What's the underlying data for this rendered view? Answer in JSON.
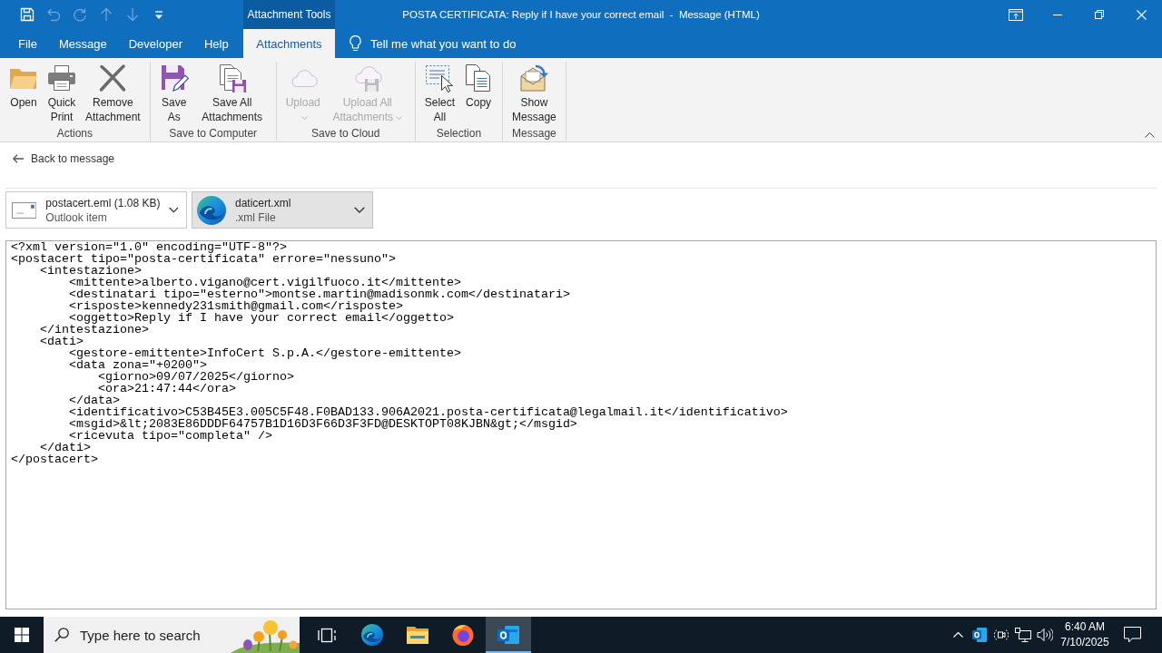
{
  "title_bar": {
    "quick_access": [
      {
        "kind": "save",
        "disabled": false
      },
      {
        "kind": "undo",
        "disabled": true
      },
      {
        "kind": "redo",
        "disabled": true
      },
      {
        "kind": "up",
        "disabled": true
      },
      {
        "kind": "down",
        "disabled": true
      },
      {
        "kind": "customize",
        "disabled": false
      }
    ],
    "title": "POSTA CERTIFICATA: Reply if I have your correct email  -  Message (HTML)"
  },
  "tabs": [
    {
      "label": "File",
      "selected": false
    },
    {
      "label": "Message",
      "selected": false
    },
    {
      "label": "Developer",
      "selected": false
    },
    {
      "label": "Help",
      "selected": false
    }
  ],
  "contextual_tab_group": {
    "header": "Attachment Tools",
    "tabs": [
      {
        "label": "Attachments",
        "selected": true
      }
    ]
  },
  "tell_me": {
    "label": "Tell me what you want to do"
  },
  "ribbon": {
    "groups": [
      {
        "label": "Actions",
        "buttons": [
          {
            "kind": "open",
            "label": "Open",
            "disabled": false,
            "menu": false
          },
          {
            "kind": "print",
            "label": "Quick Print",
            "disabled": false,
            "menu": false
          },
          {
            "kind": "remove",
            "label": "Remove Attachment",
            "disabled": false,
            "menu": false
          }
        ]
      },
      {
        "label": "Save to Computer",
        "buttons": [
          {
            "kind": "save_as",
            "label": "Save As",
            "disabled": false,
            "menu": false
          },
          {
            "kind": "save_all",
            "label": "Save All Attachments",
            "disabled": false,
            "menu": false
          }
        ]
      },
      {
        "label": "Save to Cloud",
        "buttons": [
          {
            "kind": "upload",
            "label": "Upload",
            "disabled": true,
            "menu": true
          },
          {
            "kind": "upload_all",
            "label": "Upload All Attachments",
            "disabled": true,
            "menu": true
          }
        ]
      },
      {
        "label": "Selection",
        "buttons": [
          {
            "kind": "select_all",
            "label": "Select All",
            "disabled": false,
            "menu": false
          },
          {
            "kind": "copy",
            "label": "Copy",
            "disabled": false,
            "menu": false
          }
        ]
      },
      {
        "label": "Message",
        "buttons": [
          {
            "kind": "show_message",
            "label": "Show Message",
            "disabled": false,
            "menu": false
          }
        ]
      }
    ]
  },
  "back_link": {
    "label": "Back to message"
  },
  "attachments": [
    {
      "kind": "mail",
      "name": "postacert.eml (1.08 KB)",
      "type": "Outlook item",
      "selected": false
    },
    {
      "kind": "edge",
      "name": "daticert.xml",
      "type": ".xml File",
      "selected": true
    }
  ],
  "document": {
    "lines": [
      {
        "text": "<?xml version=\"1.0\" encoding=\"UTF-8\"?>"
      },
      {
        "text": "<postacert tipo=\"posta-certificata\" errore=\"nessuno\">",
        "children": [
          {
            "text": "<intestazione>",
            "children": [
              {
                "text": "<mittente>alberto.vigano@cert.vigilfuoco.it</mittente>"
              },
              {
                "text": "<destinatari tipo=\"esterno\">montse.martin@madisonmk.com</destinatari>"
              },
              {
                "text": "<risposte>kennedy231smith@gmail.com</risposte>"
              },
              {
                "text": "<oggetto>Reply if I have your correct email</oggetto>"
              }
            ]
          },
          {
            "text": "</intestazione>"
          },
          {
            "text": "<dati>",
            "children": [
              {
                "text": "<gestore-emittente>InfoCert S.p.A.</gestore-emittente>"
              },
              {
                "text": "<data zona=\"+0200\">",
                "children": [
                  {
                    "text": "<giorno>09/07/2025</giorno>"
                  },
                  {
                    "text": "<ora>21:47:44</ora>"
                  }
                ]
              },
              {
                "text": "</data>"
              },
              {
                "text": "<identificativo>C53B45E3.005C5F48.F0BAD133.906A2021.posta-certificata@legalmail.it</identificativo>"
              },
              {
                "text": "<msgid>&lt;2083E86DDDF64757B1D16D3F66D3F3FD@DESKTOPT08KJBN&gt;</msgid>"
              },
              {
                "text": "<ricevuta tipo=\"completa\" />"
              }
            ]
          },
          {
            "text": "</dati>"
          }
        ]
      },
      {
        "text": "</postacert>"
      }
    ]
  },
  "taskbar": {
    "search": {
      "placeholder": "Type here to search"
    },
    "apps": [
      {
        "kind": "task_view",
        "selected": false
      },
      {
        "kind": "edge",
        "selected": false
      },
      {
        "kind": "explorer",
        "selected": false
      },
      {
        "kind": "firefox",
        "selected": false
      },
      {
        "kind": "outlook",
        "selected": true
      }
    ],
    "clock": {
      "time": "6:40 AM",
      "date": "7/10/2025"
    }
  }
}
